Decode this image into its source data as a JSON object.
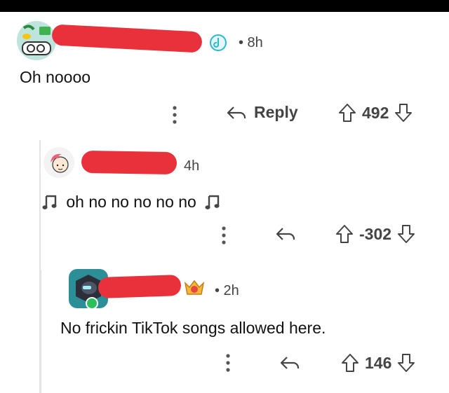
{
  "comments": [
    {
      "time": "• 8h",
      "body": "Oh noooo",
      "reply_label": "Reply",
      "votes": "492"
    },
    {
      "time": "4h",
      "body": "oh no no no no no",
      "votes": "-302"
    },
    {
      "time": "• 2h",
      "body": "No frickin TikTok songs allowed here.",
      "votes": "146"
    }
  ],
  "colors": {
    "redaction": "#e8313b",
    "online": "#2bc05c",
    "thread_line": "#e4e4e4"
  },
  "icons": [
    "more-icon",
    "reply-icon",
    "upvote-icon",
    "downvote-icon",
    "music-note-icon",
    "award-icon"
  ]
}
